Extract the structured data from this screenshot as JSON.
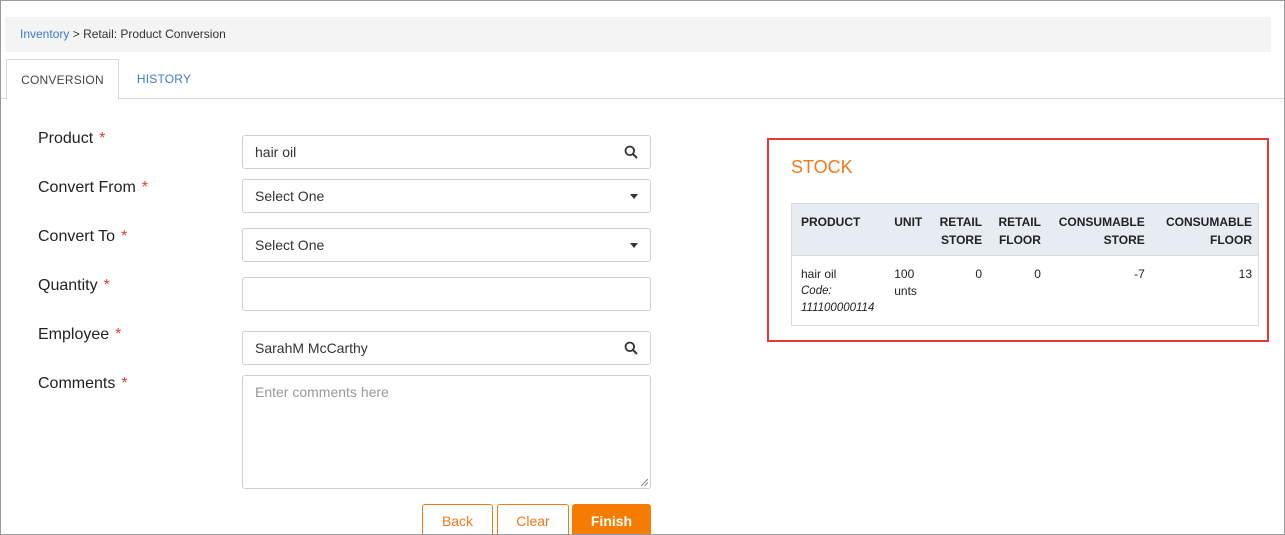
{
  "breadcrumb": {
    "parent": "Inventory",
    "separator": ">",
    "current": "Retail: Product Conversion"
  },
  "tabs": [
    {
      "label": "CONVERSION",
      "active": true
    },
    {
      "label": "HISTORY",
      "active": false
    }
  ],
  "form": {
    "product": {
      "label": "Product",
      "required_mark": "*",
      "value": "hair oil"
    },
    "convert_from": {
      "label": "Convert From",
      "required_mark": "*",
      "value": "Select One"
    },
    "convert_to": {
      "label": "Convert To",
      "required_mark": "*",
      "value": "Select One"
    },
    "quantity": {
      "label": "Quantity",
      "required_mark": "*",
      "value": ""
    },
    "employee": {
      "label": "Employee",
      "required_mark": "*",
      "value": "SarahM McCarthy"
    },
    "comments": {
      "label": "Comments",
      "required_mark": "*",
      "placeholder": "Enter comments here"
    }
  },
  "buttons": {
    "back": "Back",
    "clear": "Clear",
    "finish": "Finish"
  },
  "stock": {
    "title": "STOCK",
    "headers": {
      "product": "PRODUCT",
      "unit": "UNIT",
      "retail_store_1": "RETAIL",
      "retail_store_2": "STORE",
      "retail_floor_1": "RETAIL",
      "retail_floor_2": "FLOOR",
      "consumable_store_1": "CONSUMABLE",
      "consumable_store_2": "STORE",
      "consumable_floor_1": "CONSUMABLE",
      "consumable_floor_2": "FLOOR"
    },
    "rows": [
      {
        "product": "hair oil",
        "code_label": "Code:",
        "code": "111100000114",
        "unit_qty": "100",
        "unit_name": "unts",
        "retail_store": "0",
        "retail_floor": "0",
        "consumable_store": "-7",
        "consumable_floor": "13"
      }
    ]
  },
  "colors": {
    "accent": "#f57c00",
    "link": "#3d7cc9",
    "highlight_border": "#e53935"
  }
}
